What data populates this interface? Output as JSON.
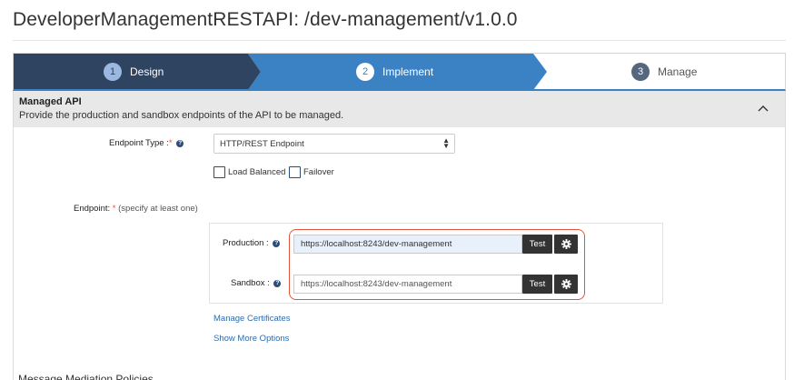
{
  "page": {
    "title": "DeveloperManagementRESTAPI: /dev-management/v1.0.0"
  },
  "wizard": {
    "steps": [
      {
        "num": "1",
        "label": "Design"
      },
      {
        "num": "2",
        "label": "Implement"
      },
      {
        "num": "3",
        "label": "Manage"
      }
    ],
    "colors": {
      "done": "#2e4460",
      "active": "#3b82c4",
      "pending": "#ffffff"
    }
  },
  "managed_api": {
    "title": "Managed API",
    "description": "Provide the production and sandbox endpoints of the API to be managed."
  },
  "form": {
    "endpoint_type_label": "Endpoint Type :",
    "required_mark": "*",
    "endpoint_type_value": "HTTP/REST Endpoint",
    "load_balanced_label": "Load Balanced",
    "failover_label": "Failover",
    "endpoint_label": "Endpoint:",
    "endpoint_hint": "(specify at least one)",
    "production_label": "Production :",
    "production_value": "https://localhost:8243/dev-management",
    "sandbox_label": "Sandbox :",
    "sandbox_placeholder": "https://localhost:8243/dev-management",
    "test_label": "Test",
    "manage_certificates": "Manage Certificates",
    "show_more_options": "Show More Options"
  },
  "next_section": {
    "title": "Message Mediation Policies"
  },
  "icons": {
    "help": "question-circle-icon",
    "gear": "gear-icon",
    "collapse": "chevron-up-icon",
    "select": "select-caret-icon"
  }
}
